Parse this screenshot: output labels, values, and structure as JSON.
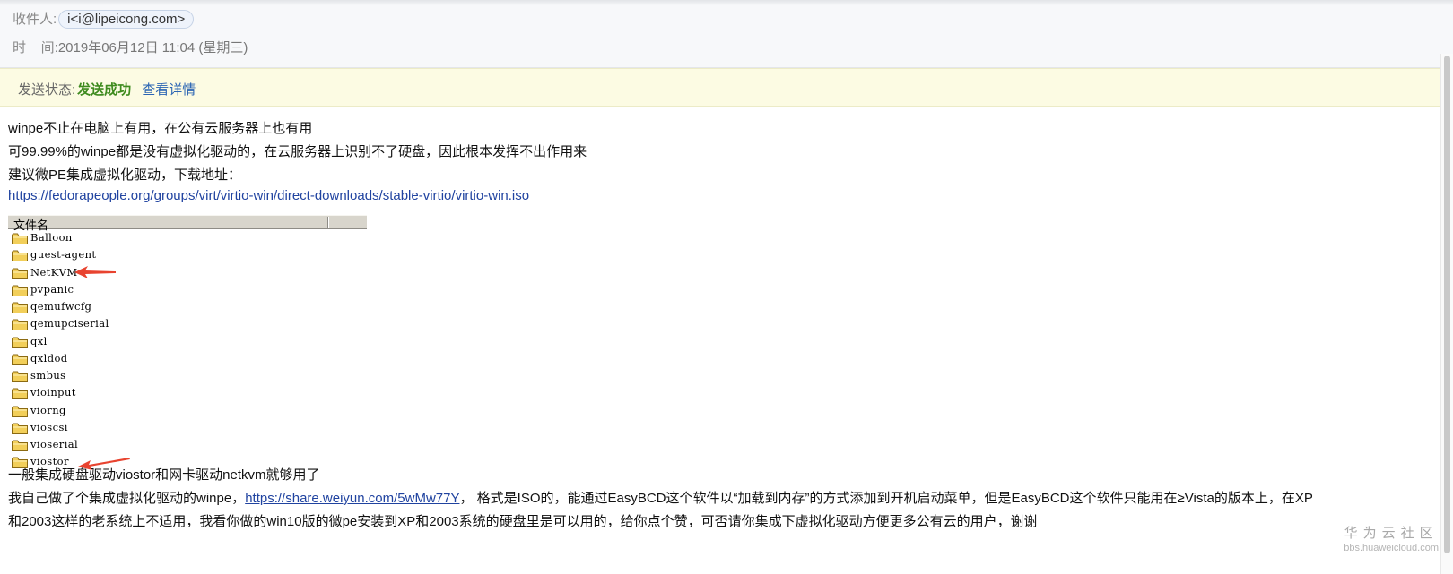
{
  "header": {
    "to_label": "收件人:",
    "recipient": "i<i@lipeicong.com>",
    "time_label": "时    间:",
    "time_value": "2019年06月12日 11:04 (星期三)"
  },
  "status": {
    "label": "发送状态:",
    "value": "发送成功",
    "details_link": "查看详情"
  },
  "message": {
    "line1": "winpe不止在电脑上有用，在公有云服务器上也有用",
    "line2": "可99.99%的winpe都是没有虚拟化驱动的，在云服务器上识别不了硬盘，因此根本发挥不出作用来",
    "line3": "建议微PE集成虚拟化驱动，下载地址：",
    "download_url": "https://fedorapeople.org/groups/virt/virtio-win/direct-downloads/stable-virtio/virtio-win.iso",
    "line4": "一般集成硬盘驱动viostor和网卡驱动netkvm就够用了",
    "line5_prefix": "我自己做了个集成虚拟化驱动的winpe，",
    "share_url": "https://share.weiyun.com/5wMw77Y",
    "line5_suffix": "， 格式是ISO的，能通过EasyBCD这个软件以“加载到内存”的方式添加到开机启动菜单，但是EasyBCD这个软件只能用在≥Vista的版本上，在XP",
    "line6": "和2003这样的老系统上不适用，我看你做的win10版的微pe安装到XP和2003系统的硬盘里是可以用的，给你点个赞，可否请你集成下虚拟化驱动方便更多公有云的用户，谢谢"
  },
  "file_list": {
    "column_header": "文件名",
    "folders": [
      "Balloon",
      "guest-agent",
      "NetKVM",
      "pvpanic",
      "qemufwcfg",
      "qemupciserial",
      "qxl",
      "qxldod",
      "smbus",
      "vioinput",
      "viorng",
      "vioscsi",
      "vioserial",
      "viostor"
    ],
    "highlighted": [
      "NetKVM",
      "viostor"
    ]
  },
  "watermark": {
    "title": "华为云社区",
    "subtitle": "bbs.huaweicloud.com"
  },
  "colors": {
    "status_success": "#3f8b1f",
    "link": "#2043a0",
    "arrow": "#e8432f"
  },
  "icons": [
    "folder-icon",
    "arrow-icon"
  ]
}
